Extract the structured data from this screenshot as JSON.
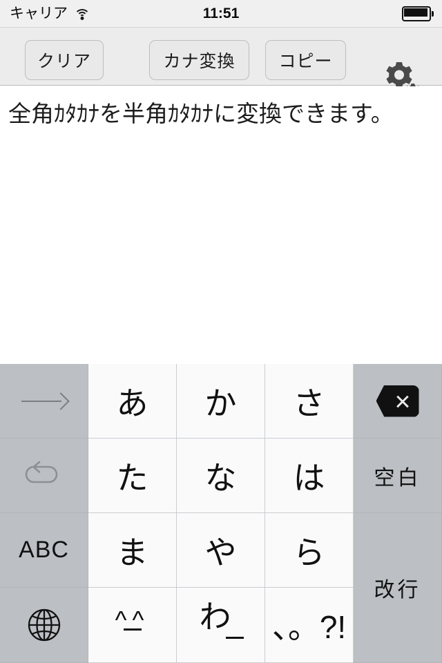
{
  "status_bar": {
    "carrier": "キャリア",
    "wifi_icon": "wifi-icon",
    "time": "11:51",
    "battery_icon": "battery-full-icon"
  },
  "toolbar": {
    "clear_label": "クリア",
    "kana_convert_label": "カナ変換",
    "copy_label": "コピー",
    "settings_icon": "gears-icon"
  },
  "content": {
    "text": "全角ｶﾀｶﾅを半角ｶﾀｶﾅに変換できます。"
  },
  "keyboard": {
    "keys": {
      "arrow_right": "→",
      "undo": "undo-arrow-icon",
      "abc": "ABC",
      "globe": "globe-icon",
      "a": "あ",
      "ka": "か",
      "sa": "さ",
      "ta": "た",
      "na": "な",
      "ha": "は",
      "ma": "ま",
      "ya": "や",
      "ra": "ら",
      "smiley": "^^",
      "smiley_underscore": "_",
      "wa": "わ",
      "wa_underscore": "_",
      "punctuation": "、。?!",
      "backspace": "backspace-icon",
      "space": "空白",
      "return": "改行"
    }
  },
  "colors": {
    "keyboard_background": "#bcbfc4",
    "kana_key": "#fafafa",
    "function_key": "#bcbfc4",
    "toolbar_background": "#ececec",
    "status_bar_background": "#f0f0f0"
  }
}
